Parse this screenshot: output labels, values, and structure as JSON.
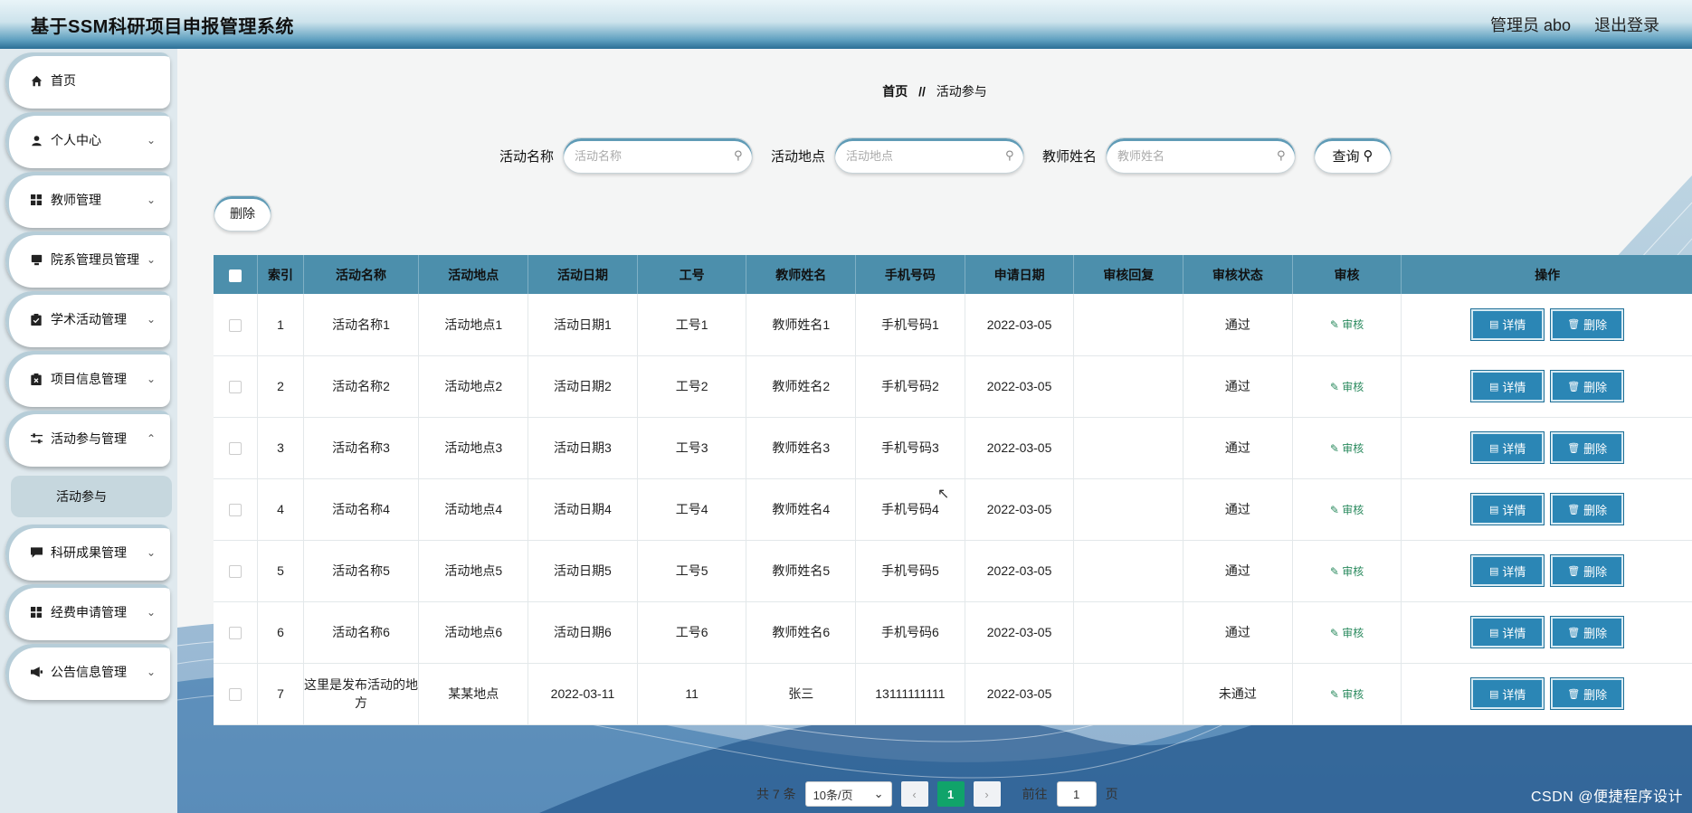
{
  "header": {
    "title": "基于SSM科研项目申报管理系统",
    "user": "管理员 abo",
    "logout": "退出登录"
  },
  "sidebar": {
    "items": [
      {
        "label": "首页",
        "icon": "home-icon"
      },
      {
        "label": "个人中心",
        "icon": "user-icon"
      },
      {
        "label": "教师管理",
        "icon": "grid-icon"
      },
      {
        "label": "院系管理员管理",
        "icon": "monitor-icon"
      },
      {
        "label": "学术活动管理",
        "icon": "clipboard-check-icon"
      },
      {
        "label": "项目信息管理",
        "icon": "clipboard-x-icon"
      },
      {
        "label": "活动参与管理",
        "icon": "sliders-icon"
      },
      {
        "label": "科研成果管理",
        "icon": "chat-icon"
      },
      {
        "label": "经费申请管理",
        "icon": "grid-icon"
      },
      {
        "label": "公告信息管理",
        "icon": "megaphone-icon"
      }
    ],
    "sub_item": "活动参与"
  },
  "breadcrumb": {
    "home": "首页",
    "sep": "//",
    "current": "活动参与"
  },
  "search": {
    "name_label": "活动名称",
    "name_placeholder": "活动名称",
    "place_label": "活动地点",
    "place_placeholder": "活动地点",
    "teacher_label": "教师姓名",
    "teacher_placeholder": "教师姓名",
    "query_label": "查询"
  },
  "delete_label": "删除",
  "table": {
    "headers": [
      "索引",
      "活动名称",
      "活动地点",
      "活动日期",
      "工号",
      "教师姓名",
      "手机号码",
      "申请日期",
      "审核回复",
      "审核状态",
      "审核",
      "操作"
    ],
    "audit_label": "审核",
    "detail_label": "详情",
    "delete_label": "删除",
    "rows": [
      {
        "idx": "1",
        "name": "活动名称1",
        "place": "活动地点1",
        "date": "活动日期1",
        "id": "工号1",
        "teacher": "教师姓名1",
        "phone": "手机号码1",
        "apply": "2022-03-05",
        "reply": "",
        "status": "通过"
      },
      {
        "idx": "2",
        "name": "活动名称2",
        "place": "活动地点2",
        "date": "活动日期2",
        "id": "工号2",
        "teacher": "教师姓名2",
        "phone": "手机号码2",
        "apply": "2022-03-05",
        "reply": "",
        "status": "通过"
      },
      {
        "idx": "3",
        "name": "活动名称3",
        "place": "活动地点3",
        "date": "活动日期3",
        "id": "工号3",
        "teacher": "教师姓名3",
        "phone": "手机号码3",
        "apply": "2022-03-05",
        "reply": "",
        "status": "通过"
      },
      {
        "idx": "4",
        "name": "活动名称4",
        "place": "活动地点4",
        "date": "活动日期4",
        "id": "工号4",
        "teacher": "教师姓名4",
        "phone": "手机号码4",
        "apply": "2022-03-05",
        "reply": "",
        "status": "通过"
      },
      {
        "idx": "5",
        "name": "活动名称5",
        "place": "活动地点5",
        "date": "活动日期5",
        "id": "工号5",
        "teacher": "教师姓名5",
        "phone": "手机号码5",
        "apply": "2022-03-05",
        "reply": "",
        "status": "通过"
      },
      {
        "idx": "6",
        "name": "活动名称6",
        "place": "活动地点6",
        "date": "活动日期6",
        "id": "工号6",
        "teacher": "教师姓名6",
        "phone": "手机号码6",
        "apply": "2022-03-05",
        "reply": "",
        "status": "通过"
      },
      {
        "idx": "7",
        "name": "这里是发布活动的地方",
        "place": "某某地点",
        "date": "2022-03-11",
        "id": "11",
        "teacher": "张三",
        "phone": "13111111111",
        "apply": "2022-03-05",
        "reply": "",
        "status": "未通过"
      }
    ]
  },
  "pager": {
    "total": "共 7 条",
    "size": "10条/页",
    "page": "1",
    "goto": "前往",
    "goto_value": "1",
    "page_unit": "页"
  },
  "watermark": "CSDN @便捷程序设计"
}
